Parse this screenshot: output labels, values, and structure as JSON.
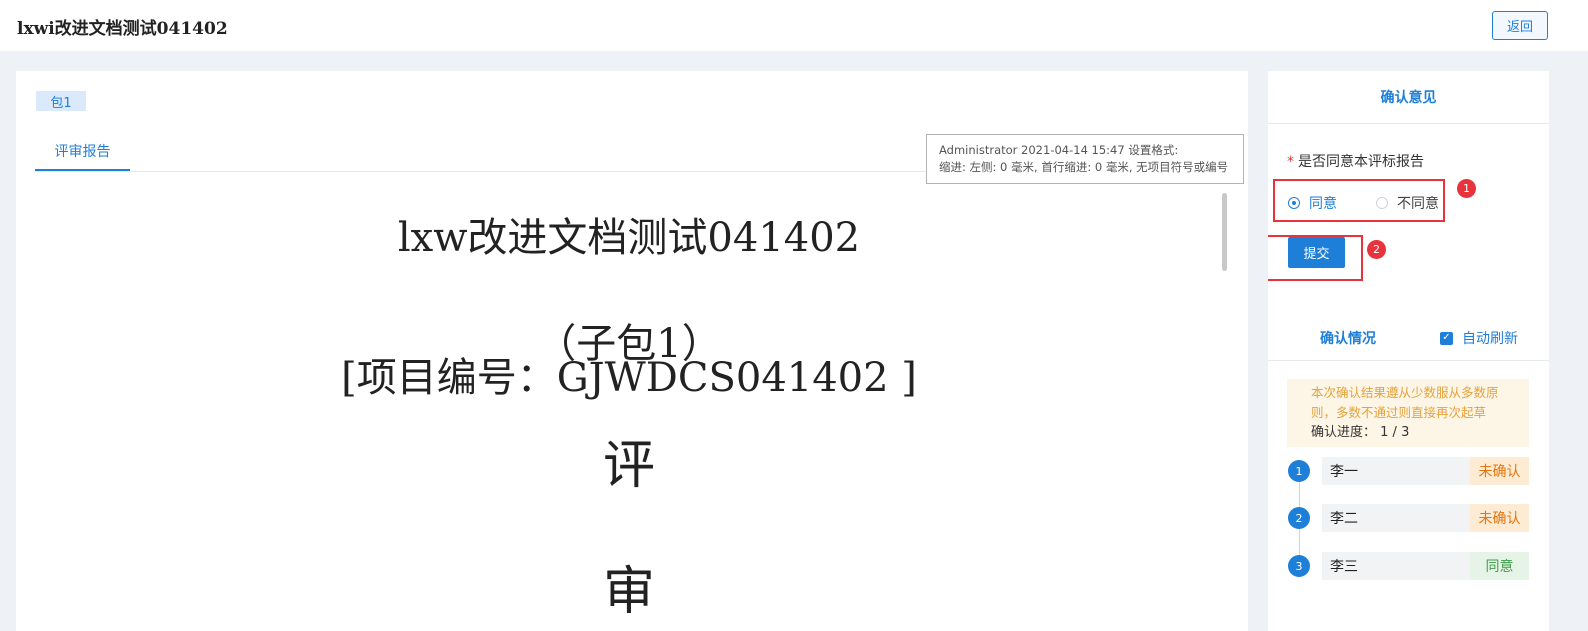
{
  "header": {
    "title": "lxwi改进文档测试041402",
    "back_label": "返回"
  },
  "main": {
    "package_tag": "包1",
    "tabs": [
      {
        "label": "评审报告"
      }
    ],
    "tooltip": {
      "line1": "Administrator 2021-04-14 15:47 设置格式:",
      "line2": "缩进: 左侧: 0 毫米, 首行缩进: 0 毫米, 无项目符号或编号"
    },
    "document": {
      "line1": "lxw改进文档测试041402",
      "line2": "（子包1）",
      "line3": "[项目编号：GJWDCS041402 ]",
      "line4": "评",
      "line5": "审"
    }
  },
  "sidebar": {
    "opinion_title": "确认意见",
    "question_required_mark": "*",
    "question": "是否同意本评标报告",
    "options": [
      {
        "label": "同意",
        "selected": true
      },
      {
        "label": "不同意",
        "selected": false
      }
    ],
    "annotations": [
      "1",
      "2"
    ],
    "submit_label": "提交",
    "confirm_title": "确认情况",
    "auto_refresh_label": "自动刷新",
    "auto_refresh_checked": true,
    "notice_text": "本次确认结果遵从少数服从多数原则，多数不通过则直接再次起草",
    "progress_label": "确认进度：",
    "progress_value": "1 / 3",
    "people": [
      {
        "index": "1",
        "name": "李一",
        "status": "未确认"
      },
      {
        "index": "2",
        "name": "李二",
        "status": "未确认"
      },
      {
        "index": "3",
        "name": "李三",
        "status": "同意"
      }
    ]
  },
  "colors": {
    "accent": "#1e7fd8",
    "annotation_red": "#e8323c",
    "pending_bg": "#fdebd3",
    "pending_text": "#e6740e",
    "agreed_bg": "#e6f4e8",
    "agreed_text": "#3f9c4a",
    "notice_bg": "#fdf6e6",
    "notice_text": "#e6a23c"
  }
}
